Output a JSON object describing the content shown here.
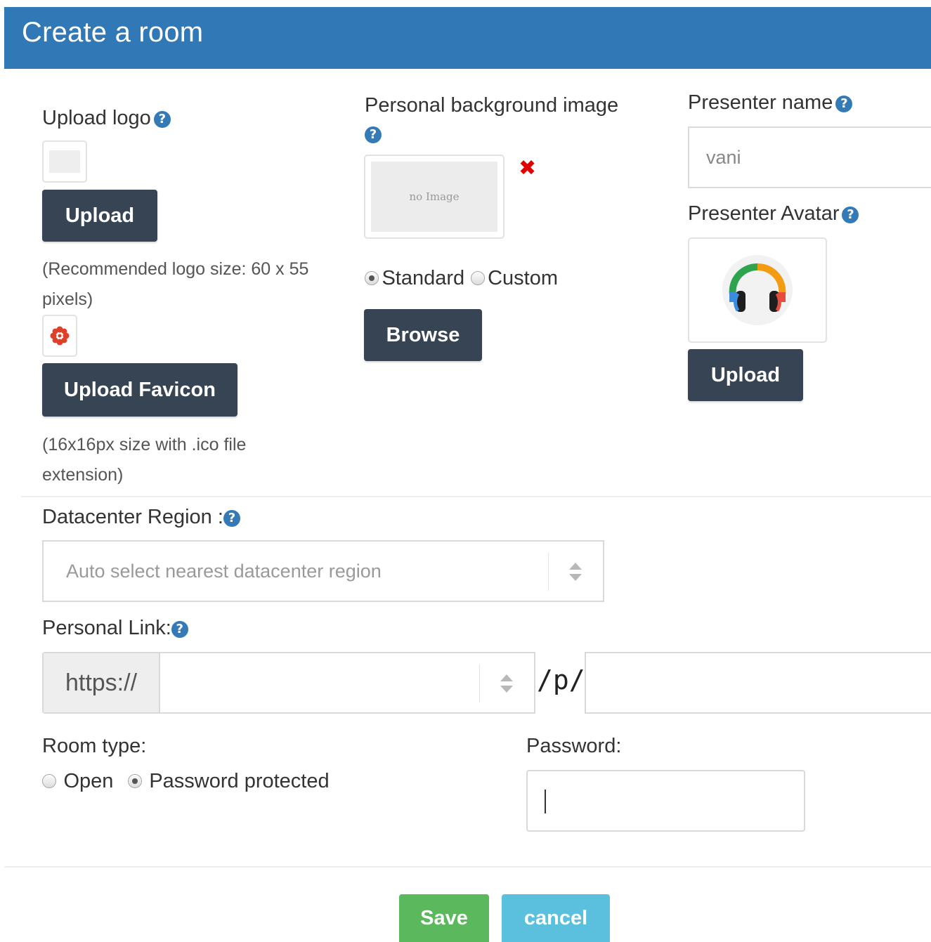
{
  "header": {
    "title": "Create a room"
  },
  "upload_logo": {
    "label": "Upload logo",
    "button": "Upload",
    "note": "(Recommended logo size: 60 x 55 pixels)",
    "favicon_button": "Upload Favicon",
    "favicon_note": "(16x16px size with .ico file extension)"
  },
  "background": {
    "label": "Personal background image",
    "no_image_text": "no Image",
    "options": [
      "Standard",
      "Custom"
    ],
    "selected_option": "Standard",
    "browse_button": "Browse"
  },
  "presenter": {
    "name_label": "Presenter name",
    "name_value": "vani",
    "avatar_label": "Presenter Avatar",
    "upload_button": "Upload"
  },
  "datacenter": {
    "label": "Datacenter Region :",
    "selected": "Auto select nearest datacenter region"
  },
  "personal_link": {
    "label": "Personal Link:",
    "protocol": "https://",
    "path_separator": "/p/",
    "domain_value": "",
    "slug_value": ""
  },
  "room_type": {
    "label": "Room type:",
    "options": [
      "Open",
      "Password protected"
    ],
    "selected": "Password protected"
  },
  "password": {
    "label": "Password:",
    "value": ""
  },
  "footer": {
    "save": "Save",
    "cancel": "cancel"
  },
  "colors": {
    "header": "#3178b6",
    "dark_button": "#364454",
    "save_button": "#5cb85c",
    "cancel_button": "#5bc0de",
    "help_icon": "#337ab7",
    "remove_icon": "#e00000"
  }
}
